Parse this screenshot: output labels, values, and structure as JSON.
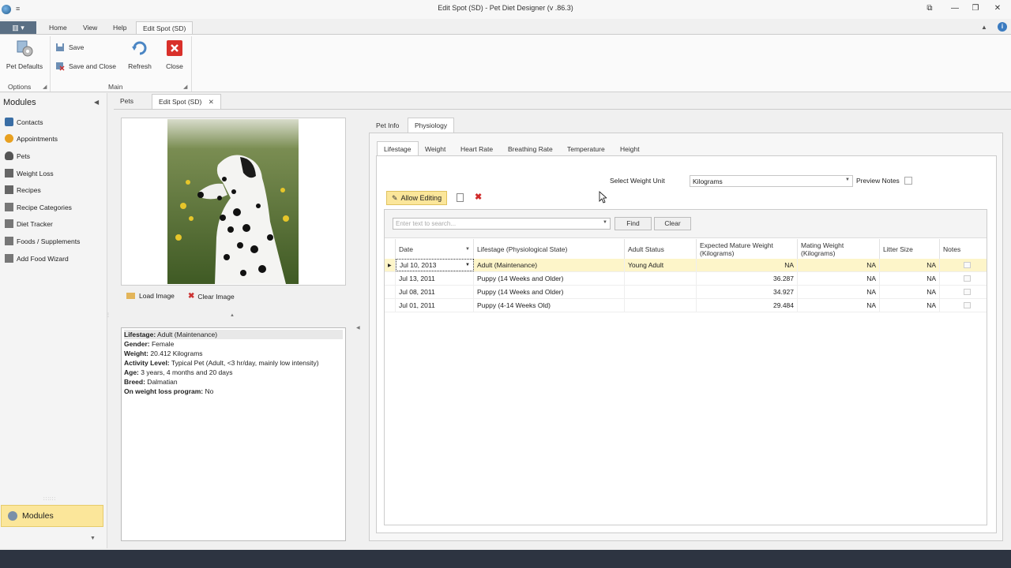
{
  "window": {
    "title": "Edit Spot (SD) - Pet Diet Designer (v .86.3)",
    "quick_access": "≡",
    "controls": [
      "⧉",
      "—",
      "❐",
      "✕"
    ]
  },
  "ribbon": {
    "file_label": "▥ ▾",
    "tabs": [
      "Home",
      "View",
      "Help",
      "Edit Spot (SD)"
    ],
    "buttons": {
      "pet_defaults": "Pet Defaults",
      "save": "Save",
      "save_close": "Save and Close",
      "refresh": "Refresh",
      "close": "Close"
    },
    "groups": {
      "options": "Options",
      "main": "Main"
    }
  },
  "modules": {
    "header": "Modules",
    "items": [
      {
        "label": "Contacts",
        "icon": "contacts-icon",
        "color": "#3a6ea5"
      },
      {
        "label": "Appointments",
        "icon": "appointments-icon",
        "color": "#e8a020"
      },
      {
        "label": "Pets",
        "icon": "pets-icon",
        "color": "#555555"
      },
      {
        "label": "Weight Loss",
        "icon": "weight-loss-icon",
        "color": "#666666"
      },
      {
        "label": "Recipes",
        "icon": "recipes-icon",
        "color": "#666666"
      },
      {
        "label": "Recipe Categories",
        "icon": "recipe-categories-icon",
        "color": "#777777"
      },
      {
        "label": "Diet Tracker",
        "icon": "diet-tracker-icon",
        "color": "#777777"
      },
      {
        "label": "Foods / Supplements",
        "icon": "foods-icon",
        "color": "#777777"
      },
      {
        "label": "Add Food Wizard",
        "icon": "wizard-icon",
        "color": "#777777"
      }
    ],
    "footer_button": "Modules"
  },
  "doc_tabs": [
    "Pets",
    "Edit Spot (SD)"
  ],
  "photo": {
    "load_label": "Load Image",
    "clear_label": "Clear Image"
  },
  "info": [
    {
      "key": "Lifestage:",
      "value": " Adult (Maintenance)"
    },
    {
      "key": "Gender:",
      "value": " Female"
    },
    {
      "key": "Weight:",
      "value": " 20.412 Kilograms"
    },
    {
      "key": "Activity Level:",
      "value": " Typical Pet (Adult, <3 hr/day, mainly low intensity)"
    },
    {
      "key": "Age:",
      "value": " 3 years, 4 months and 20 days"
    },
    {
      "key": "Breed:",
      "value": " Dalmatian"
    },
    {
      "key": "On weight loss program:",
      "value": " No"
    }
  ],
  "main_tabs": [
    "Pet Info",
    "Physiology"
  ],
  "sub_tabs": [
    "Lifestage",
    "Weight",
    "Heart Rate",
    "Breathing Rate",
    "Temperature",
    "Height"
  ],
  "controls": {
    "weight_unit_label": "Select Weight Unit",
    "weight_unit_value": "Kilograms",
    "preview_notes_label": "Preview Notes",
    "allow_editing": "Allow Editing",
    "search_placeholder": "Enter text to search...",
    "find": "Find",
    "clear": "Clear"
  },
  "grid": {
    "columns": [
      "Date",
      "Lifestage (Physiological State)",
      "Adult Status",
      "Expected Mature Weight (Kilograms)",
      "Mating Weight (Kilograms)",
      "Litter Size",
      "Notes"
    ],
    "rows": [
      [
        "Jul 10, 2013",
        "Adult (Maintenance)",
        "Young Adult",
        "NA",
        "NA",
        "NA"
      ],
      [
        "Jul 13, 2011",
        "Puppy (14 Weeks and Older)",
        "",
        "36.287",
        "NA",
        "NA"
      ],
      [
        "Jul 08, 2011",
        "Puppy (14 Weeks and Older)",
        "",
        "34.927",
        "NA",
        "NA"
      ],
      [
        "Jul 01, 2011",
        "Puppy (4-14 Weeks Old)",
        "",
        "29.484",
        "NA",
        "NA"
      ]
    ]
  }
}
